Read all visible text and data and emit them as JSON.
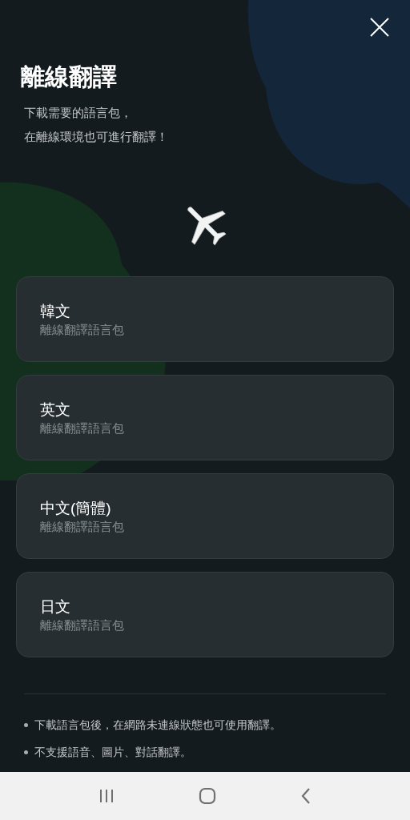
{
  "title": "離線翻譯",
  "subtitle_lines": [
    "下載需要的語言包，",
    "在離線環境也可進行翻譯！"
  ],
  "language_packs": [
    {
      "name": "韓文",
      "description": "離線翻譯語言包"
    },
    {
      "name": "英文",
      "description": "離線翻譯語言包"
    },
    {
      "name": "中文(簡體)",
      "description": "離線翻譯語言包"
    },
    {
      "name": "日文",
      "description": "離線翻譯語言包"
    }
  ],
  "notes": [
    "下載語言包後，在網路未連線狀態也可使用翻譯。",
    "不支援語音、圖片、對話翻譯。"
  ]
}
